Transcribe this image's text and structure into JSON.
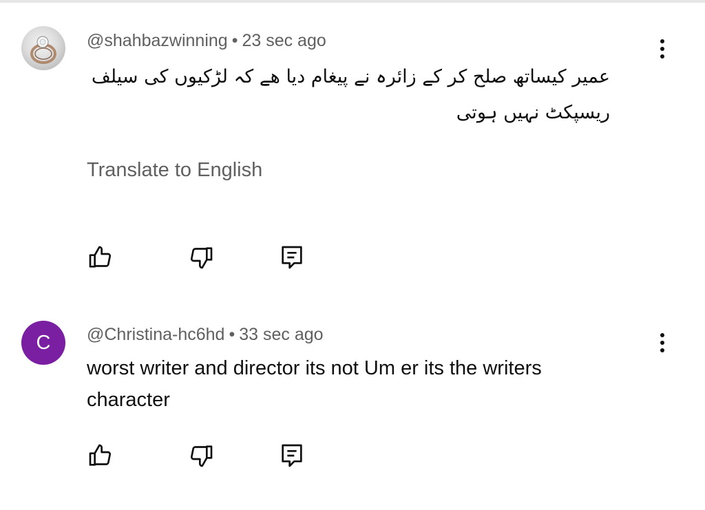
{
  "comments": [
    {
      "author": "@shahbazwinning",
      "separator": "•",
      "time": "23 sec ago",
      "text": "عمیر کیساتھ صلح کر کے زائرہ نے پیغام دیا ھے کہ لڑکیوں کی سیلف ریسپکٹ نہیں ہوتی",
      "translate_label": "Translate to English",
      "avatar_icon": "ring-photo-avatar"
    },
    {
      "author": "@Christina-hc6hd",
      "separator": "•",
      "time": "33 sec ago",
      "text": "worst writer and director its not Um er  its the writers character",
      "avatar_letter": "C",
      "avatar_color": "#7b1fa2"
    }
  ],
  "icons": {
    "like": "thumbs-up-icon",
    "dislike": "thumbs-down-icon",
    "reply": "reply-comment-icon",
    "more": "more-vertical-icon"
  }
}
